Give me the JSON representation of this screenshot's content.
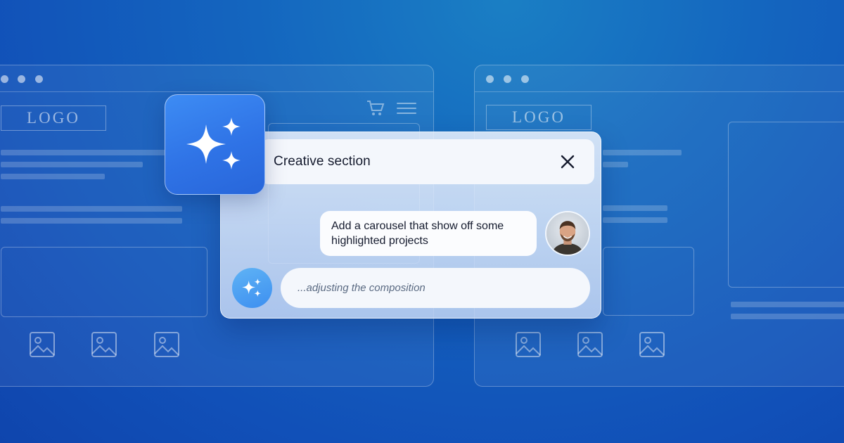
{
  "left_window": {
    "logo_text": "LOGO"
  },
  "right_window": {
    "logo_text": "LOGO"
  },
  "icons": {
    "tile": "sparkles-icon",
    "close": "close-icon",
    "cart": "shopping-cart-icon",
    "menu": "hamburger-menu-icon",
    "image": "image-placeholder-icon",
    "bot": "sparkles-icon"
  },
  "colors": {
    "background": "#1466bf",
    "accent": "#2f73e6",
    "text_dark": "#151b2e",
    "text_muted": "#5a6a82"
  },
  "chat": {
    "title": "Creative section",
    "user_message": "Add a carousel that show off some highlighted projects",
    "bot_status": "...adjusting the composition"
  }
}
